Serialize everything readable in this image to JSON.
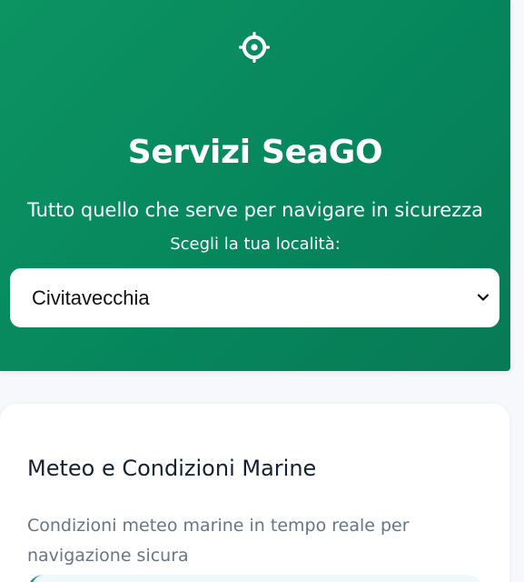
{
  "header": {
    "icon": "steering-wheel-icon",
    "title": "Servizi SeaGO",
    "subtitle": "Tutto quello che serve per navigare in sicurezza",
    "location_label": "Scegli la tua località:",
    "selected_location": "Civitavecchia"
  },
  "service_card": {
    "title": "Meteo e Condizioni Marine",
    "description": "Condizioni meteo marine in tempo reale per navigazione sicura"
  },
  "colors": {
    "hero_green": "#0d9463",
    "text_dark": "#172033",
    "text_muted": "#687487",
    "accent_teal": "#119180"
  }
}
